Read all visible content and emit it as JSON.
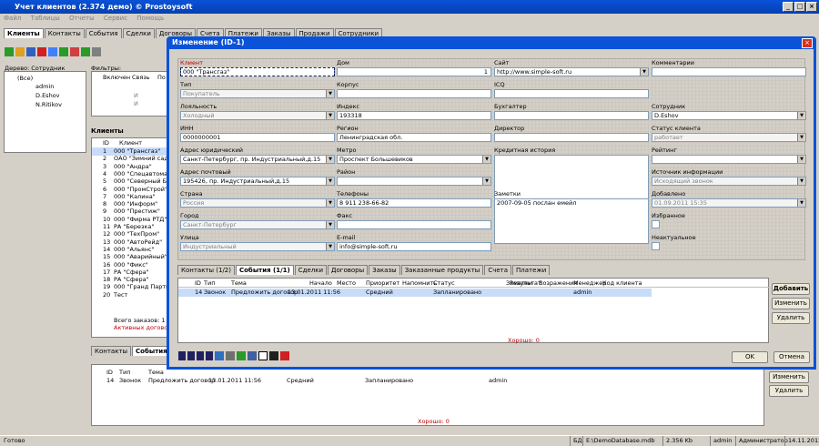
{
  "app": {
    "title": "Учет клиентов (2.374 демо) © Prostoysoft"
  },
  "menu": [
    "Файл",
    "Таблицы",
    "Отчеты",
    "Сервис",
    "Помощь"
  ],
  "main_tabs": [
    "Клиенты",
    "Контакты",
    "События",
    "Сделки",
    "Договоры",
    "Счета",
    "Платежи",
    "Заказы",
    "Продажи",
    "Сотрудники"
  ],
  "left": {
    "tree_label": "Дерево: Сотрудник",
    "tree_items": [
      "(Все)",
      "admin",
      "D.Eshov",
      "N.Ritikov"
    ],
    "filter_label": "Фильтры:",
    "filter_cols": [
      "Включен",
      "Связь",
      "По"
    ],
    "filter_rows": [
      "И",
      "И"
    ],
    "clients_header": "Клиенты",
    "clients_cols": [
      "ID",
      "Клиент"
    ],
    "clients": [
      {
        "id": "1",
        "name": "000 \"Трансгаз\""
      },
      {
        "id": "2",
        "name": "ОАО \"Зимний сад\""
      },
      {
        "id": "3",
        "name": "000 \"Андра\""
      },
      {
        "id": "4",
        "name": "000 \"Спецавтомат"
      },
      {
        "id": "5",
        "name": "000 \"Северный Бр"
      },
      {
        "id": "6",
        "name": "000 \"ПромСтрой\""
      },
      {
        "id": "7",
        "name": "000 \"Калина\""
      },
      {
        "id": "8",
        "name": "000 \"Информ\""
      },
      {
        "id": "9",
        "name": "000 \"Престиж\""
      },
      {
        "id": "10",
        "name": "000 \"Фирма РТД\""
      },
      {
        "id": "11",
        "name": "РА \"Березка\""
      },
      {
        "id": "12",
        "name": "000 \"ТехПром\""
      },
      {
        "id": "13",
        "name": "000 \"АвтоРейд\""
      },
      {
        "id": "14",
        "name": "000 \"Альянс\""
      },
      {
        "id": "15",
        "name": "000 \"Аварийный\""
      },
      {
        "id": "16",
        "name": "000 \"Фикс\""
      },
      {
        "id": "17",
        "name": "РА \"Сфера\""
      },
      {
        "id": "18",
        "name": "РА \"Сфера\""
      },
      {
        "id": "19",
        "name": "000 \"Гранд Партне"
      },
      {
        "id": "20",
        "name": "Тест"
      }
    ],
    "summary": [
      "Всего заказов: 1",
      "Активных договоро"
    ]
  },
  "bottom": {
    "tabs": [
      "Контакты",
      "События"
    ],
    "cols": [
      "ID",
      "Тип",
      "Тема",
      "Начало",
      "Место",
      "Приоритет",
      "Напомнить",
      "Статус",
      "Заметки",
      "Результат",
      "Возражения",
      "Менеджер",
      "Код клиента"
    ],
    "row": {
      "id": "14",
      "type": "Звонок",
      "topic": "Предложить договор",
      "start": "13.01.2011 11:56",
      "priority": "Средний",
      "status": "Запланировано",
      "manager": "admin"
    },
    "footer": "Хорошо: 0",
    "buttons": [
      "Изменить",
      "Удалить"
    ]
  },
  "dialog": {
    "title": "Изменение (ID-1)",
    "fields": {
      "client": {
        "label": "Клиент",
        "value": "000 \"Трансгаз\""
      },
      "house": {
        "label": "Дом",
        "value": "1"
      },
      "site": {
        "label": "Сайт",
        "value": "http://www.simple-soft.ru"
      },
      "comments": {
        "label": "Комментарии",
        "value": ""
      },
      "type": {
        "label": "Тип",
        "value": "Покупатель"
      },
      "corp": {
        "label": "Корпус",
        "value": ""
      },
      "icq": {
        "label": "ICQ",
        "value": ""
      },
      "loyalty": {
        "label": "Лояльность",
        "value": "Холодный"
      },
      "index": {
        "label": "Индекс",
        "value": "193318"
      },
      "accountant": {
        "label": "Бухгалтер",
        "value": ""
      },
      "employee": {
        "label": "Сотрудник",
        "value": "D.Eshov"
      },
      "inn": {
        "label": "ИНН",
        "value": "0000000001"
      },
      "region": {
        "label": "Регион",
        "value": "Ленинградская обл."
      },
      "director": {
        "label": "Директор",
        "value": ""
      },
      "status": {
        "label": "Статус клиента",
        "value": "работает"
      },
      "legal": {
        "label": "Адрес юридический",
        "value": "Санкт-Петербург, пр. Индустриальный,д.15"
      },
      "metro": {
        "label": "Метро",
        "value": "Проспект Большевиков"
      },
      "credit": {
        "label": "Кредитная история",
        "value": ""
      },
      "rating": {
        "label": "Рейтинг",
        "value": ""
      },
      "postal": {
        "label": "Адрес почтовый",
        "value": "195426, пр. Индустриальный,д.15"
      },
      "district": {
        "label": "Район",
        "value": ""
      },
      "source": {
        "label": "Источник информации",
        "value": "Исходящий звонок"
      },
      "country": {
        "label": "Страна",
        "value": "Россия"
      },
      "phones": {
        "label": "Телефоны",
        "value": "8 911 238-66-82"
      },
      "notes": {
        "label": "Заметки",
        "value": "2007-09-05 послан емейл"
      },
      "added": {
        "label": "Добавлено",
        "value": "01.09.2011 15:35"
      },
      "city": {
        "label": "Город",
        "value": "Санкт-Петербург"
      },
      "fax": {
        "label": "Факс",
        "value": ""
      },
      "fav": {
        "label": "Избранное",
        "value": ""
      },
      "street": {
        "label": "Улица",
        "value": "Индустриальный"
      },
      "email": {
        "label": "E-mail",
        "value": "info@simple-soft.ru"
      },
      "inactive": {
        "label": "Неактуальное",
        "value": ""
      }
    },
    "tabs": [
      "Контакты (1/2)",
      "События (1/1)",
      "Сделки",
      "Договоры",
      "Заказы",
      "Заказанные продукты",
      "Счета",
      "Платежи"
    ],
    "cols": [
      "ID",
      "Тип",
      "Тема",
      "Начало",
      "Место",
      "Приоритет",
      "Напомнить",
      "Статус",
      "Заметки",
      "Результат",
      "Возражения",
      "Менеджер",
      "Код клиента"
    ],
    "row": {
      "id": "14",
      "type": "Звонок",
      "topic": "Предложить договор",
      "start": "13.01.2011 11:56",
      "priority": "Средний",
      "status": "Запланировано",
      "manager": "admin"
    },
    "footer": "Хорошо: 0",
    "side_buttons": [
      "Добавить",
      "Изменить",
      "Удалить"
    ],
    "ok": "OK",
    "cancel": "Отмена"
  },
  "status": {
    "left": "Готово",
    "db": "БД:",
    "path": "E:\\DemoDatabase.mdb",
    "size": "2.356 Kb",
    "user": "admin",
    "role": "Администратор",
    "date": "14.11.2012"
  }
}
